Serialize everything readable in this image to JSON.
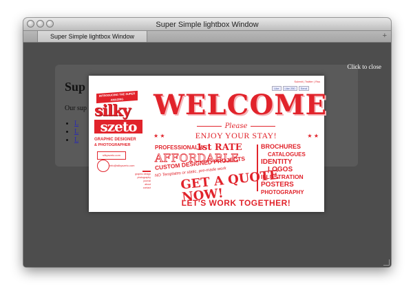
{
  "window": {
    "title": "Super Simple lightbox Window",
    "tab_label": "Super Simple lightbox Window",
    "new_tab_symbol": "+"
  },
  "underlying_page": {
    "heading": "Sup",
    "text": "Our sup",
    "list_items": [
      "L",
      "L",
      "L"
    ]
  },
  "lightbox": {
    "close_text": "Click to close",
    "top_nav": "Submit | Twitter | Rss",
    "share": [
      "Like",
      "Like 250",
      "Send"
    ],
    "sidebar": {
      "ribbon": "INTRODUCING THE SUPER AMAZING",
      "logo_top": "silky",
      "logo_bottom": "szeto",
      "line1": "GRAPHIC DESIGNER",
      "line2": "& PHOTOGRAPHER",
      "box_text": "silkyszeto.com",
      "email": "info@silkyszeto.com",
      "nav": [
        "graphic design",
        "photography",
        "journal",
        "about",
        "contact"
      ]
    },
    "poster": {
      "welcome": "WELCOME",
      "please": "Please",
      "enjoy": "ENJOY YOUR STAY!",
      "stars": "★ ★",
      "professional": "PROFESSIONAL &",
      "first_rate": "1st RATE",
      "affordable": "AFFORDABLE",
      "custom": "CUSTOM DESIGNED PROJECTS",
      "no_templates": "NO Templates or static, pre-made work",
      "get_a_quote": "GET A QUOTE NOW!",
      "services": [
        "BROCHURES",
        "CATALOGUES",
        "IDENTITY",
        "LOGOS",
        "ILLUSTRATION",
        "POSTERS",
        "PHOTOGRAPHY"
      ],
      "together": "LET'S WORK TOGETHER!"
    }
  },
  "colors": {
    "accent_red": "#e1232b",
    "overlay": "#4d4d4d"
  }
}
